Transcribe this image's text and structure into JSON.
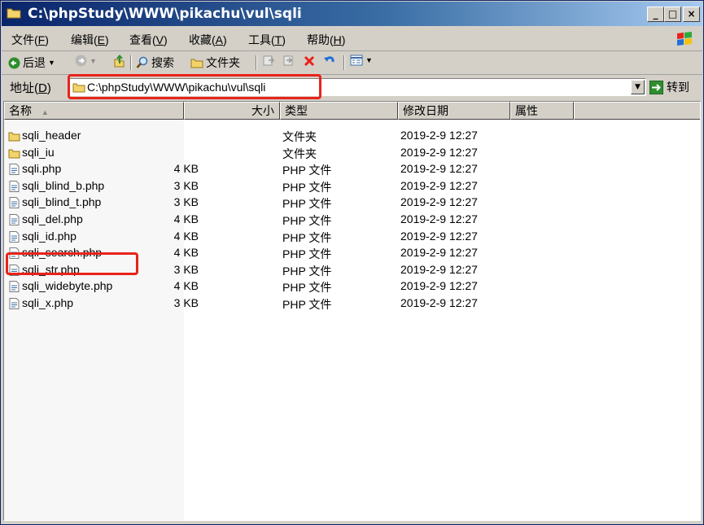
{
  "window": {
    "title": "C:\\phpStudy\\WWW\\pikachu\\vul\\sqli",
    "buttons": {
      "minimize": "_",
      "maximize": "□",
      "close": "×"
    }
  },
  "menubar": [
    {
      "label": "文件(",
      "key": "F",
      "suffix": ")"
    },
    {
      "label": "编辑(",
      "key": "E",
      "suffix": ")"
    },
    {
      "label": "查看(",
      "key": "V",
      "suffix": ")"
    },
    {
      "label": "收藏(",
      "key": "A",
      "suffix": ")"
    },
    {
      "label": "工具(",
      "key": "T",
      "suffix": ")"
    },
    {
      "label": "帮助(",
      "key": "H",
      "suffix": ")"
    }
  ],
  "toolbar": {
    "back": "后退",
    "search": "搜索",
    "folders": "文件夹"
  },
  "address": {
    "label": "地址(",
    "key": "D",
    "suffix": ")",
    "value": "C:\\phpStudy\\WWW\\pikachu\\vul\\sqli",
    "go": "转到"
  },
  "columns": {
    "name": "名称",
    "size": "大小",
    "type": "类型",
    "modified": "修改日期",
    "attributes": "属性"
  },
  "files": [
    {
      "name": "sqli_header",
      "size": "",
      "type": "文件夹",
      "modified": "2019-2-9 12:27",
      "kind": "folder"
    },
    {
      "name": "sqli_iu",
      "size": "",
      "type": "文件夹",
      "modified": "2019-2-9 12:27",
      "kind": "folder"
    },
    {
      "name": "sqli.php",
      "size": "4 KB",
      "type": "PHP 文件",
      "modified": "2019-2-9 12:27",
      "kind": "file"
    },
    {
      "name": "sqli_blind_b.php",
      "size": "3 KB",
      "type": "PHP 文件",
      "modified": "2019-2-9 12:27",
      "kind": "file"
    },
    {
      "name": "sqli_blind_t.php",
      "size": "3 KB",
      "type": "PHP 文件",
      "modified": "2019-2-9 12:27",
      "kind": "file"
    },
    {
      "name": "sqli_del.php",
      "size": "4 KB",
      "type": "PHP 文件",
      "modified": "2019-2-9 12:27",
      "kind": "file"
    },
    {
      "name": "sqli_id.php",
      "size": "4 KB",
      "type": "PHP 文件",
      "modified": "2019-2-9 12:27",
      "kind": "file"
    },
    {
      "name": "sqli_search.php",
      "size": "4 KB",
      "type": "PHP 文件",
      "modified": "2019-2-9 12:27",
      "kind": "file"
    },
    {
      "name": "sqli_str.php",
      "size": "3 KB",
      "type": "PHP 文件",
      "modified": "2019-2-9 12:27",
      "kind": "file"
    },
    {
      "name": "sqli_widebyte.php",
      "size": "4 KB",
      "type": "PHP 文件",
      "modified": "2019-2-9 12:27",
      "kind": "file"
    },
    {
      "name": "sqli_x.php",
      "size": "3 KB",
      "type": "PHP 文件",
      "modified": "2019-2-9 12:27",
      "kind": "file"
    }
  ],
  "colors": {
    "highlight": "#e8231a",
    "titlebar": "#0a246a",
    "chrome": "#d4d0c8"
  }
}
